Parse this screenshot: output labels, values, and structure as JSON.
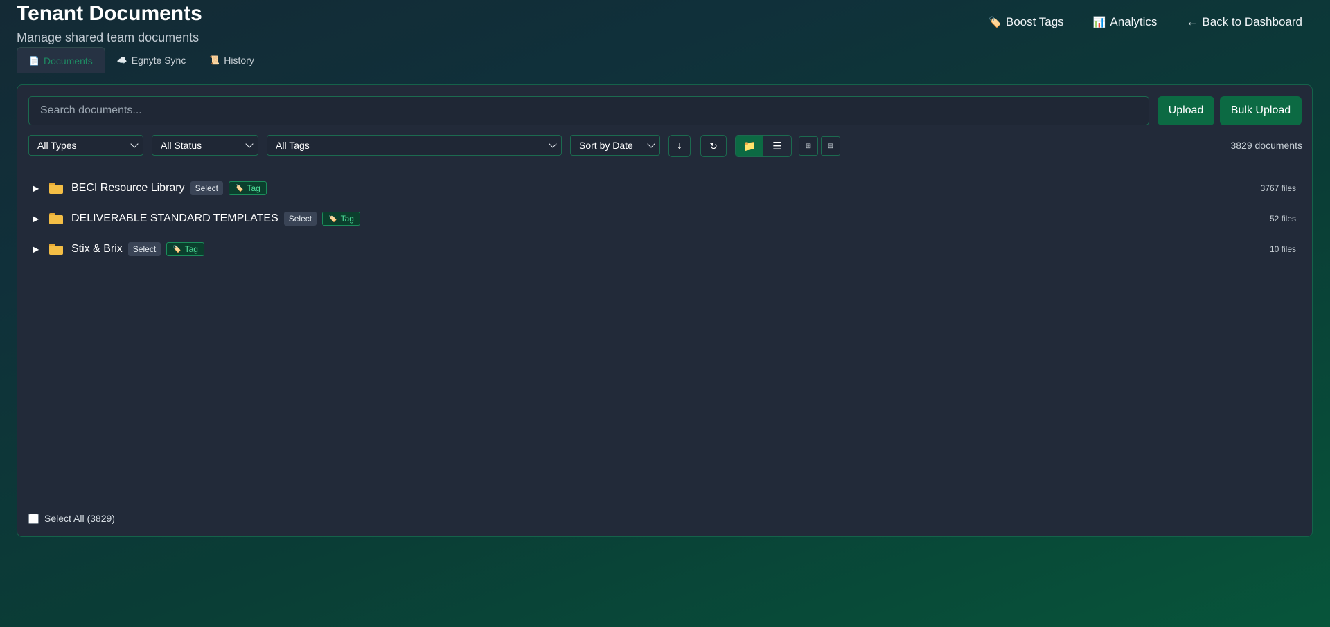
{
  "header": {
    "title": "Tenant Documents",
    "subtitle": "Manage shared team documents",
    "actions": [
      {
        "icon": "🏷️",
        "label": "Boost Tags"
      },
      {
        "icon": "📊",
        "label": "Analytics"
      },
      {
        "icon": "←",
        "label": "Back to Dashboard"
      }
    ]
  },
  "tabs": [
    {
      "icon": "📄",
      "label": "Documents",
      "active": true
    },
    {
      "icon": "☁️",
      "label": "Egnyte Sync",
      "active": false
    },
    {
      "icon": "📜",
      "label": "History",
      "active": false
    }
  ],
  "toolbar": {
    "search_placeholder": "Search documents...",
    "upload_label": "Upload",
    "bulk_upload_label": "Bulk Upload",
    "type_filter": "All Types",
    "status_filter": "All Status",
    "tag_filter": "All Tags",
    "sort": "Sort by Date",
    "sort_direction_icon": "↓",
    "refresh_icon": "↻",
    "folder_view_icon": "📁",
    "list_view_icon": "☰",
    "expand_all_icon": "⊞",
    "collapse_all_icon": "⊟",
    "doc_count": "3829 documents"
  },
  "folders": [
    {
      "name": "BECI Resource Library",
      "select_label": "Select",
      "tag_label": "Tag",
      "file_count": "3767 files"
    },
    {
      "name": "DELIVERABLE STANDARD TEMPLATES",
      "select_label": "Select",
      "tag_label": "Tag",
      "file_count": "52 files"
    },
    {
      "name": "Stix & Brix",
      "select_label": "Select",
      "tag_label": "Tag",
      "file_count": "10 files"
    }
  ],
  "footer": {
    "select_all_label": "Select All (3829)"
  },
  "icons": {
    "chevron": "▶",
    "tag": "🏷️"
  },
  "colors": {
    "accent_green": "#0c6a43",
    "tag_green": "#4ddc98",
    "panel_bg": "#222a39",
    "folder_yellow": "#f4be45"
  }
}
